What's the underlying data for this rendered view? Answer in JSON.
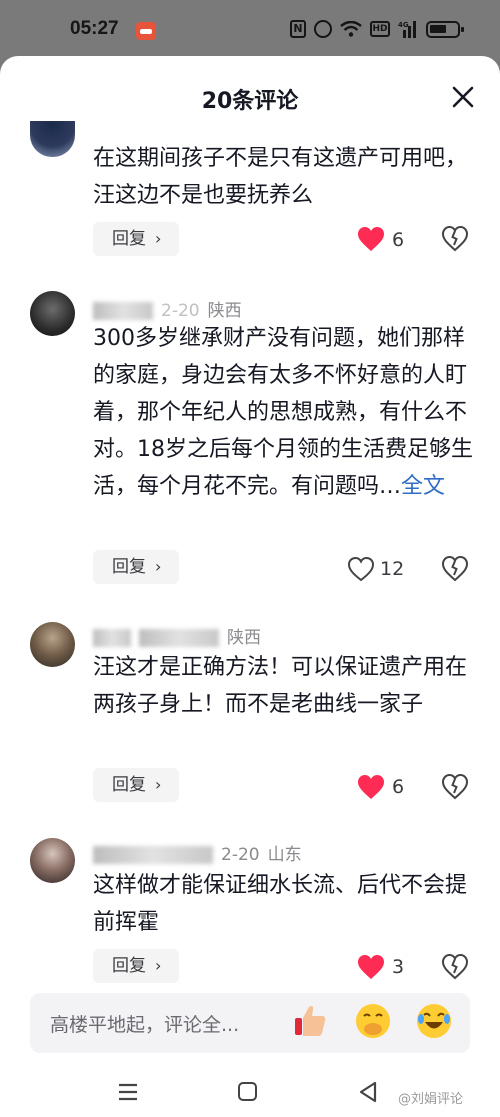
{
  "status_bar": {
    "time": "05:27",
    "hd_label": "HD",
    "network_label": "4G"
  },
  "header": {
    "title": "20条评论"
  },
  "comments": [
    {
      "text": "在这期间孩子不是只有这遗产可用吧，汪这边不是也要抚养么",
      "reply_label": "回复",
      "likes": "6",
      "liked": true
    },
    {
      "author": "于雪菜",
      "date": "2-20",
      "location": "陕西",
      "text": "300多岁继承财产没有问题，她们那样的家庭，身边会有太多不怀好意的人盯着，那个年纪人的思想成熟，有什么不对。18岁之后每个月领的生活费足够生活，每个月花不完。有问题吗…",
      "full_text_link": "全文",
      "reply_label": "回复",
      "likes": "12",
      "liked": false
    },
    {
      "author": "黑宝",
      "date": "5小时前",
      "location": "陕西",
      "text": "汪这才是正确方法！可以保证遗产用在两孩子身上！而不是老曲线一家子",
      "reply_label": "回复",
      "likes": "6",
      "liked": true
    },
    {
      "author": "夏至未至",
      "date": "2-20",
      "location": "山东",
      "text": "这样做才能保证细水长流、后代不会提前挥霍",
      "reply_label": "回复",
      "likes": "3",
      "liked": true
    }
  ],
  "input": {
    "placeholder": "高楼平地起，评论全..."
  },
  "emojis": [
    "thumbs-up-emoji",
    "hand-over-mouth-emoji",
    "laughing-crying-emoji"
  ],
  "watermark": "@刘娟评论",
  "colors": {
    "like_red": "#fe2c55",
    "link_blue": "#2f6dc7",
    "text": "#161823",
    "meta": "#8a8a8f"
  }
}
